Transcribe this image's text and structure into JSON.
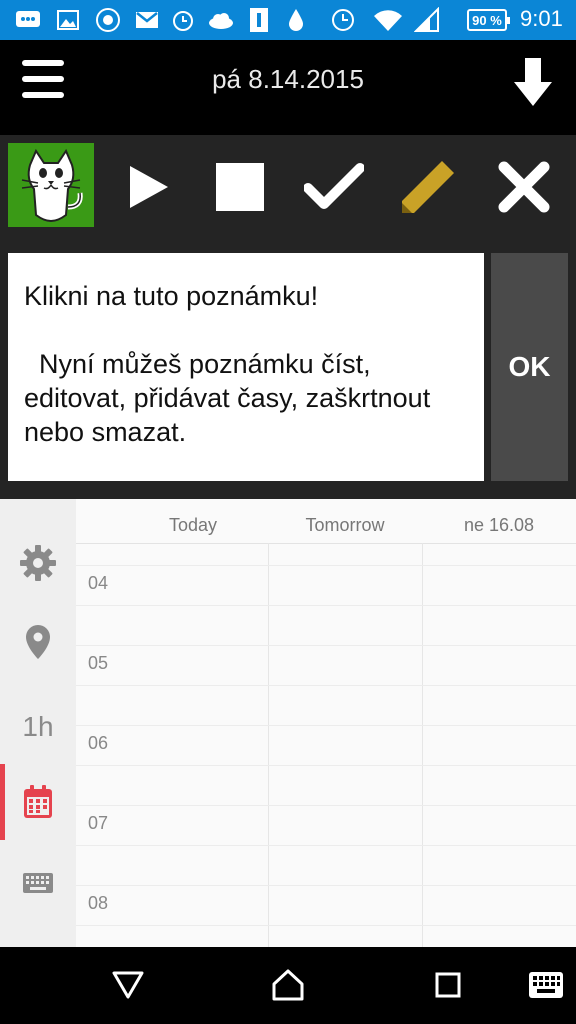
{
  "status_bar": {
    "battery": "90 %",
    "time": "9:01",
    "icons": [
      "message-icon",
      "image-icon",
      "app-icon",
      "gmail-icon",
      "alarm-clock-icon",
      "cloud-icon",
      "info-icon",
      "drop-icon",
      "clock-icon",
      "wifi-icon",
      "signal-icon"
    ]
  },
  "header": {
    "date": "pá 8.14.2015"
  },
  "toolbar": {
    "icons": [
      "cat-avatar-icon",
      "play-icon",
      "stop-icon",
      "check-icon",
      "pencil-icon",
      "close-icon"
    ]
  },
  "note": {
    "line1": "Klikni na tuto poznámku!",
    "body": "  Nyní můžeš poznámku číst, editovat, přidávat časy, zaškrtnout nebo smazat.",
    "ok_label": "OK"
  },
  "sidebar": {
    "items": [
      "gear-icon",
      "location-pin-icon",
      "1h",
      "calendar-icon",
      "keyboard-icon"
    ],
    "hour_label": "1h",
    "active_color": "#e5434e"
  },
  "calendar": {
    "columns": [
      "Today",
      "Tomorrow",
      "ne 16.08"
    ],
    "hours": [
      "04",
      "05",
      "06",
      "07",
      "08"
    ]
  },
  "colors": {
    "status_bar": "#0b86d6",
    "avatar_bg": "#3a9a16",
    "pencil": "#c9a227",
    "ok_bg": "#4a4a4a"
  }
}
